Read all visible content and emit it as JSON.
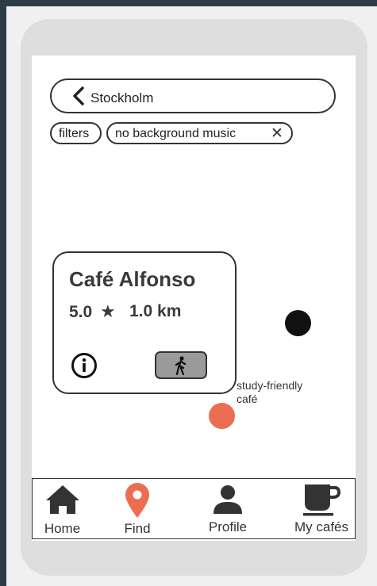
{
  "search": {
    "location": "Stockholm"
  },
  "filters": {
    "filters_label": "filters",
    "active_filter": "no background music",
    "remove_symbol": "✕"
  },
  "cafe_card": {
    "name": "Café Alfonso",
    "rating": "5.0",
    "star": "★",
    "distance": "1.0 km"
  },
  "map": {
    "marker_label": "study-friendly café",
    "marker_color": "#ec6e52",
    "user_dot_color": "#111111"
  },
  "tabbar": {
    "home": "Home",
    "find": "Find",
    "profile": "Profile",
    "my_cafes": "My cafés",
    "active_color": "#ec6e52"
  },
  "icons": {
    "back": "chevron-left-icon",
    "info": "info-icon",
    "walk": "walking-person-icon",
    "home": "home-icon",
    "find": "map-pin-icon",
    "profile": "person-icon",
    "my_cafes": "coffee-cup-icon"
  }
}
